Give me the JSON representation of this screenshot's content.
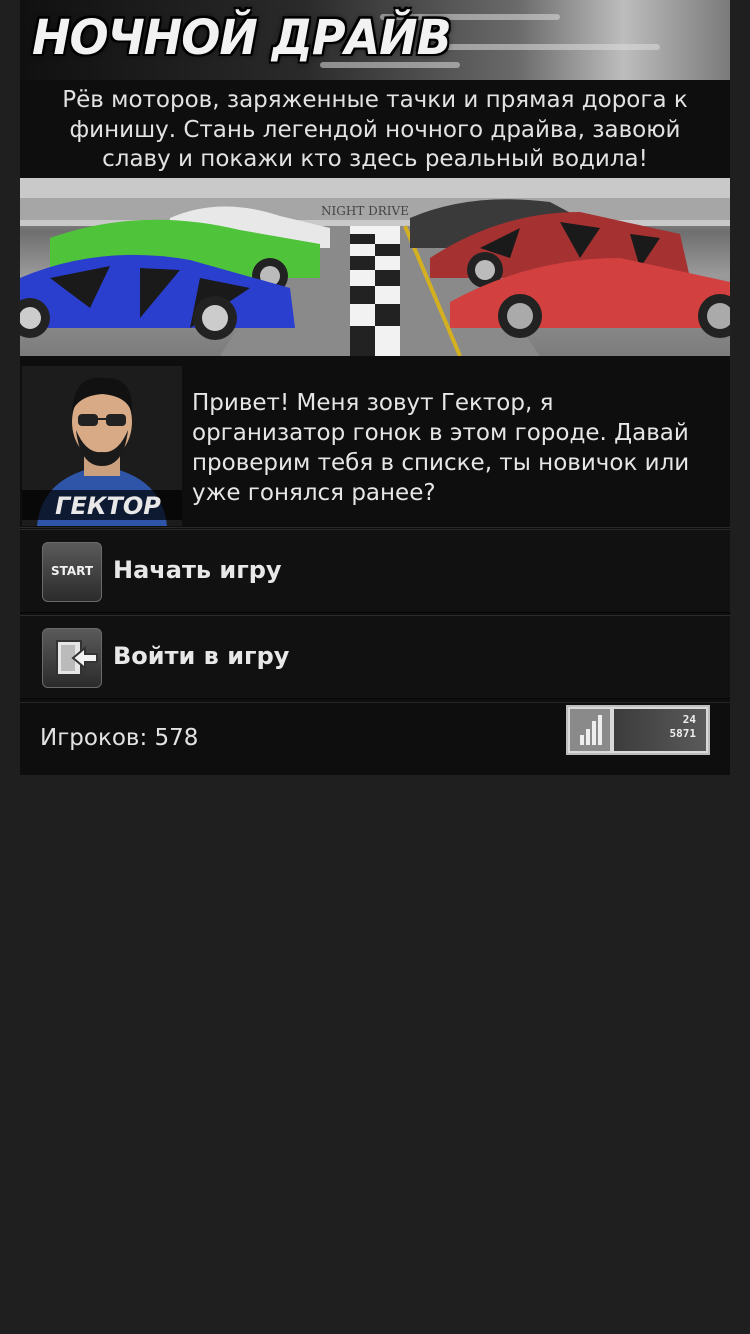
{
  "logo": {
    "title": "НОЧНОЙ ДРАЙВ"
  },
  "intro": "Рёв моторов, заряженные тачки и прямая дорога к финишу. Стань легендой ночного драйва, завоюй славу и покажи кто здесь реальный водила!",
  "race_banner": {
    "sign": "NIGHT DRIVE"
  },
  "host": {
    "name": "ГЕКТОР",
    "greeting": "Привет! Меня зовут Гектор, я организатор гонок в этом городе. Давай проверим тебя в списке, ты новичок или уже гонялся ранее?"
  },
  "menu": [
    {
      "icon": "start-icon",
      "icon_text": "START",
      "label": "Начать игру"
    },
    {
      "icon": "login-icon",
      "label": "Войти в игру"
    }
  ],
  "stats": {
    "players": "Игроков: 578",
    "counter": {
      "today": "24",
      "total": "5871"
    }
  },
  "colors": {
    "background": "#1f1f1f",
    "panel": "#0f0e0e",
    "text": "#e6e6e6"
  }
}
